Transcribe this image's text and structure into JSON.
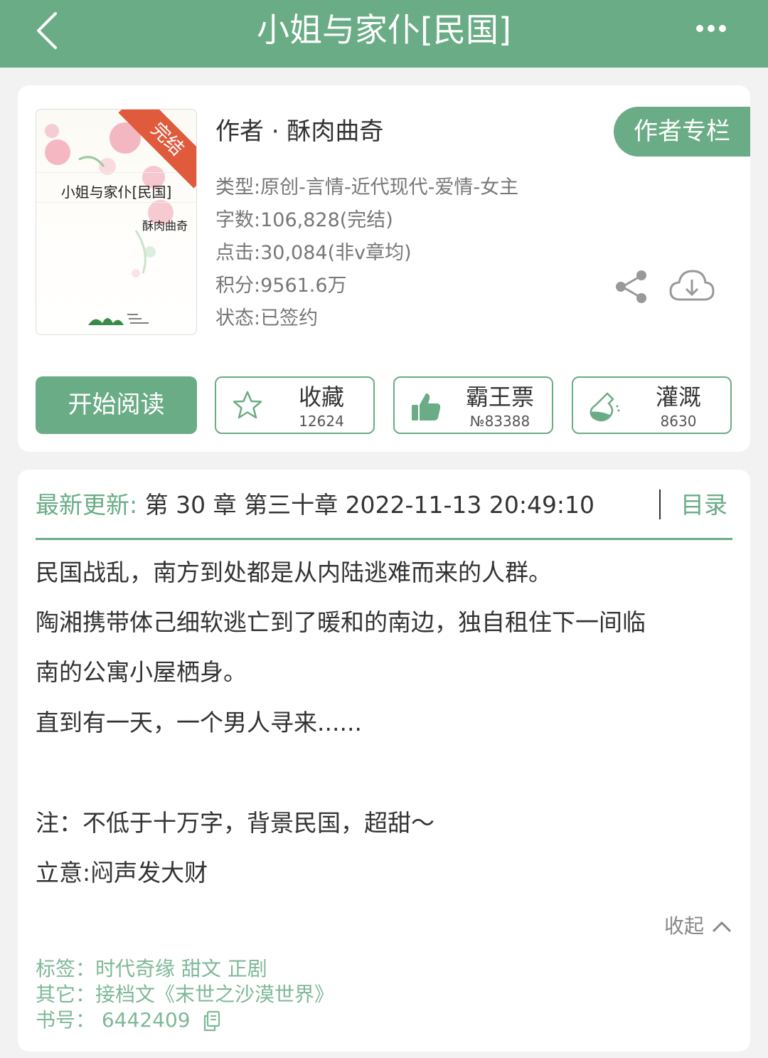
{
  "header": {
    "title": "小姐与家仆[民国]"
  },
  "book": {
    "cover": {
      "badge": "完结",
      "title": "小姐与家仆[民国]",
      "author": "酥肉曲奇"
    },
    "author_line": "作者 · 酥肉曲奇",
    "author_column_label": "作者专栏",
    "type": "类型:原创-言情-近代现代-爱情-女主",
    "word_count": "字数:106,828(完结)",
    "clicks": "点击:30,084(非v章均)",
    "points": "积分:9561.6万",
    "status": "状态:已签约"
  },
  "actions": {
    "read_label": "开始阅读",
    "favorite": {
      "label": "收藏",
      "count": "12624"
    },
    "vote": {
      "label": "霸王票",
      "count": "№83388"
    },
    "nutrient": {
      "label": "灌溉",
      "count": "8630"
    }
  },
  "update": {
    "label": "最新更新:",
    "text": " 第 30 章 第三十章 2022-11-13 20:49:10",
    "toc_label": "目录"
  },
  "description": {
    "lines": [
      "民国战乱，南方到处都是从内陆逃难而来的人群。",
      "陶湘携带体己细软逃亡到了暖和的南边，独自租住下一间临",
      "南的公寓小屋栖身。",
      "直到有一天，一个男人寻来......",
      "注：不低于十万字，背景民国，超甜～",
      "立意:闷声发大财"
    ],
    "collapse_label": "收起"
  },
  "footer": {
    "tags": "标签：时代奇缘  甜文  正剧",
    "other": "其它：接档文《末世之沙漠世界》",
    "book_id": "书号：  6442409"
  },
  "colors": {
    "accent": "#6aac86",
    "ribbon": "#e05a3c"
  }
}
